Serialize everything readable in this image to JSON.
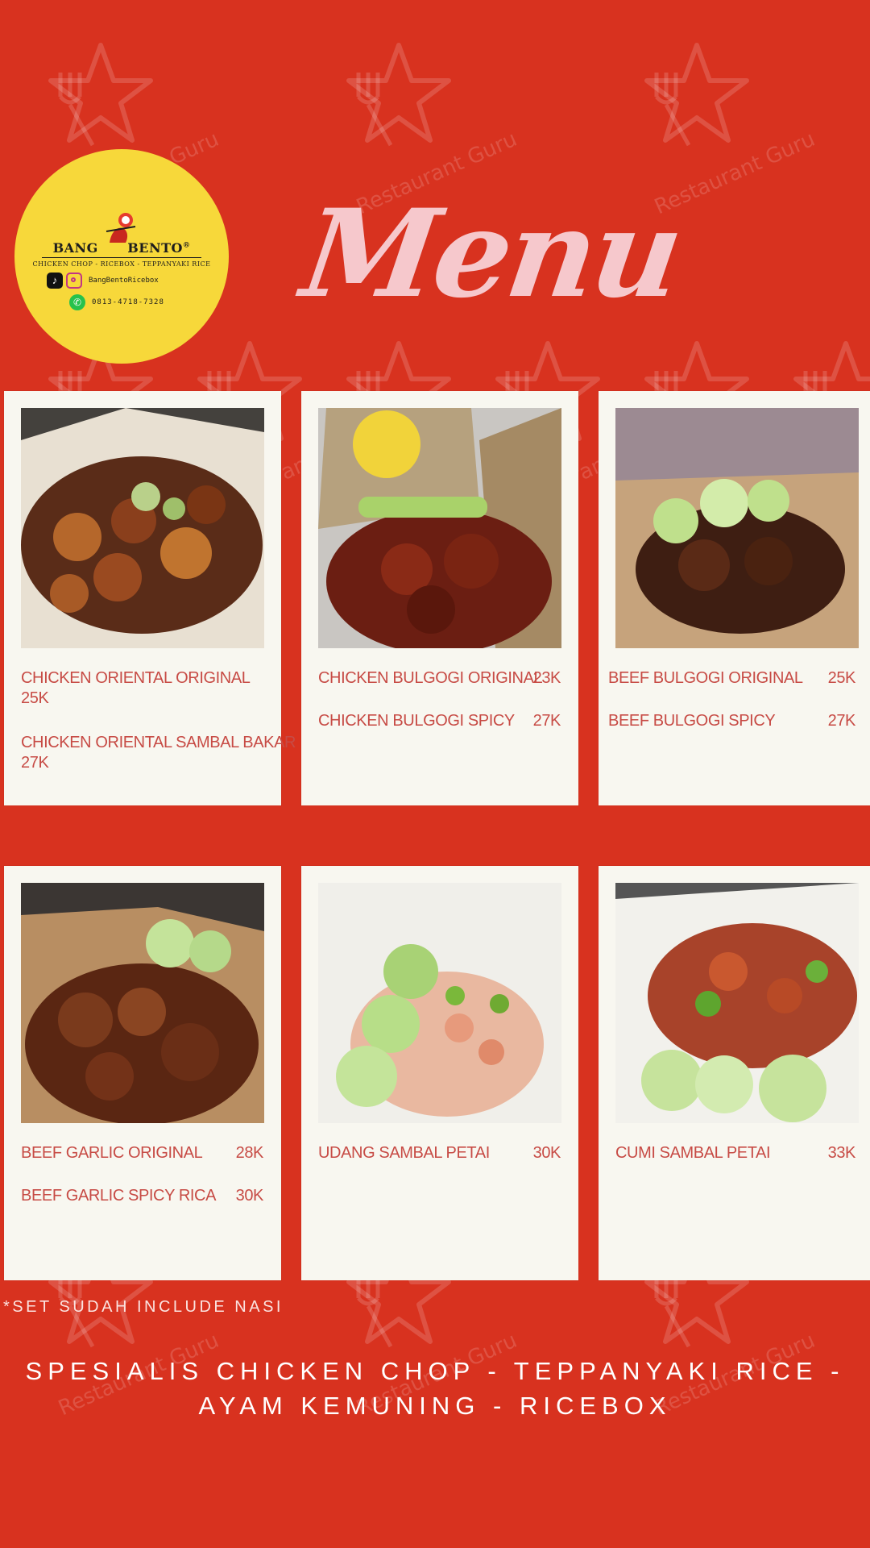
{
  "logo": {
    "brand_left": "BANG",
    "brand_right": "BENTO",
    "registered": "®",
    "tagline": "CHICKEN CHOP - RICEBOX - TEPPANYAKI RICE",
    "social_handle": "BangBentoRicebox",
    "phone": "0813-4718-7328",
    "tiktok_icon": "tiktok-icon",
    "instagram_icon": "instagram-icon",
    "whatsapp_icon": "whatsapp-icon"
  },
  "title": "Menu",
  "watermark": "Restaurant Guru",
  "cards": [
    {
      "photo": "chicken-oriental-photo",
      "items": [
        {
          "name": "CHICKEN ORIENTAL ORIGINAL",
          "price": "25K"
        },
        {
          "name": "CHICKEN ORIENTAL SAMBAL BAKAR",
          "price": "27K"
        }
      ]
    },
    {
      "photo": "chicken-bulgogi-photo",
      "items": [
        {
          "name": "CHICKEN BULGOGI ORIGINAL",
          "price": "23K"
        },
        {
          "name": "CHICKEN BULGOGI SPICY",
          "price": "27K"
        }
      ]
    },
    {
      "photo": "beef-bulgogi-photo",
      "items": [
        {
          "name": "BEEF BULGOGI ORIGINAL",
          "price": "25K"
        },
        {
          "name": "BEEF BULGOGI SPICY",
          "price": "27K"
        }
      ]
    },
    {
      "photo": "beef-garlic-photo",
      "items": [
        {
          "name": "BEEF GARLIC ORIGINAL",
          "price": "28K"
        },
        {
          "name": "BEEF GARLIC SPICY RICA",
          "price": "30K"
        }
      ]
    },
    {
      "photo": "udang-sambal-petai-photo",
      "items": [
        {
          "name": "UDANG SAMBAL PETAI",
          "price": "30K"
        }
      ]
    },
    {
      "photo": "cumi-sambal-petai-photo",
      "items": [
        {
          "name": "CUMI SAMBAL PETAI",
          "price": "33K"
        }
      ]
    }
  ],
  "note": "*SET SUDAH INCLUDE NASI",
  "specialties_line1": "SPESIALIS CHICKEN CHOP - TEPPANYAKI RICE -",
  "specialties_line2": "AYAM KEMUNING - RICEBOX",
  "colors": {
    "background": "#d8321f",
    "card": "#f8f7f0",
    "item_text": "#c74b45",
    "title": "#f6c8cc",
    "logo": "#f7d83a"
  }
}
